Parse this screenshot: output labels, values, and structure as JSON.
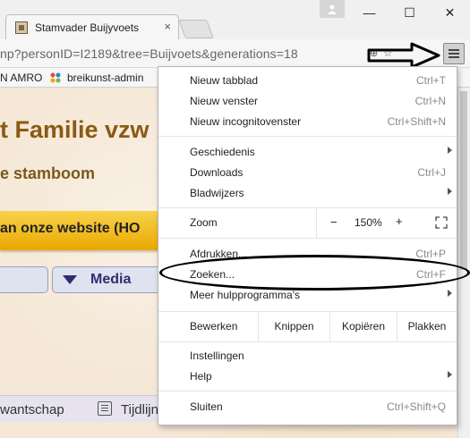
{
  "browser": {
    "tab_title": "Stamvader Buijyvoets",
    "tab_close": "×",
    "url": "np?personID=I2189&tree=Buijvoets&generations=18",
    "url_icons": [
      "⊕",
      "☆"
    ],
    "window_buttons": {
      "minimize": "—",
      "maximize": "☐",
      "close": "✕"
    }
  },
  "bookmarks": [
    {
      "label": "N AMRO"
    },
    {
      "label": "breikunst-admin"
    }
  ],
  "page": {
    "heading": "t Familie vzw",
    "subheading": "e stamboom",
    "banner": "an onze website (HO",
    "nav_tab": "Media",
    "bottom_items": [
      "wantschap",
      "Tijdlijn"
    ]
  },
  "menu": {
    "items_top": [
      {
        "label": "Nieuw tabblad",
        "shortcut": "Ctrl+T"
      },
      {
        "label": "Nieuw venster",
        "shortcut": "Ctrl+N"
      },
      {
        "label": "Nieuw incognitovenster",
        "shortcut": "Ctrl+Shift+N"
      }
    ],
    "items_history": [
      {
        "label": "Geschiedenis",
        "shortcut": ""
      },
      {
        "label": "Downloads",
        "shortcut": "Ctrl+J"
      },
      {
        "label": "Bladwijzers",
        "shortcut": ""
      }
    ],
    "zoom": {
      "label": "Zoom",
      "minus": "−",
      "value": "150%",
      "plus": "+"
    },
    "items_tools": [
      {
        "label": "Afdrukken...",
        "shortcut": "Ctrl+P"
      },
      {
        "label": "Zoeken...",
        "shortcut": "Ctrl+F"
      },
      {
        "label": "Meer hulpprogramma's",
        "shortcut": ""
      }
    ],
    "edit": {
      "label": "Bewerken",
      "cut": "Knippen",
      "copy": "Kopiëren",
      "paste": "Plakken"
    },
    "items_settings": [
      {
        "label": "Instellingen",
        "shortcut": ""
      },
      {
        "label": "Help",
        "shortcut": ""
      }
    ],
    "exit": {
      "label": "Sluiten",
      "shortcut": "Ctrl+Shift+Q"
    }
  },
  "colors": {
    "heading": "#8a5a14",
    "banner": "#f2c21c",
    "nav_text": "#2b2f6e",
    "annotation": "#000000"
  }
}
